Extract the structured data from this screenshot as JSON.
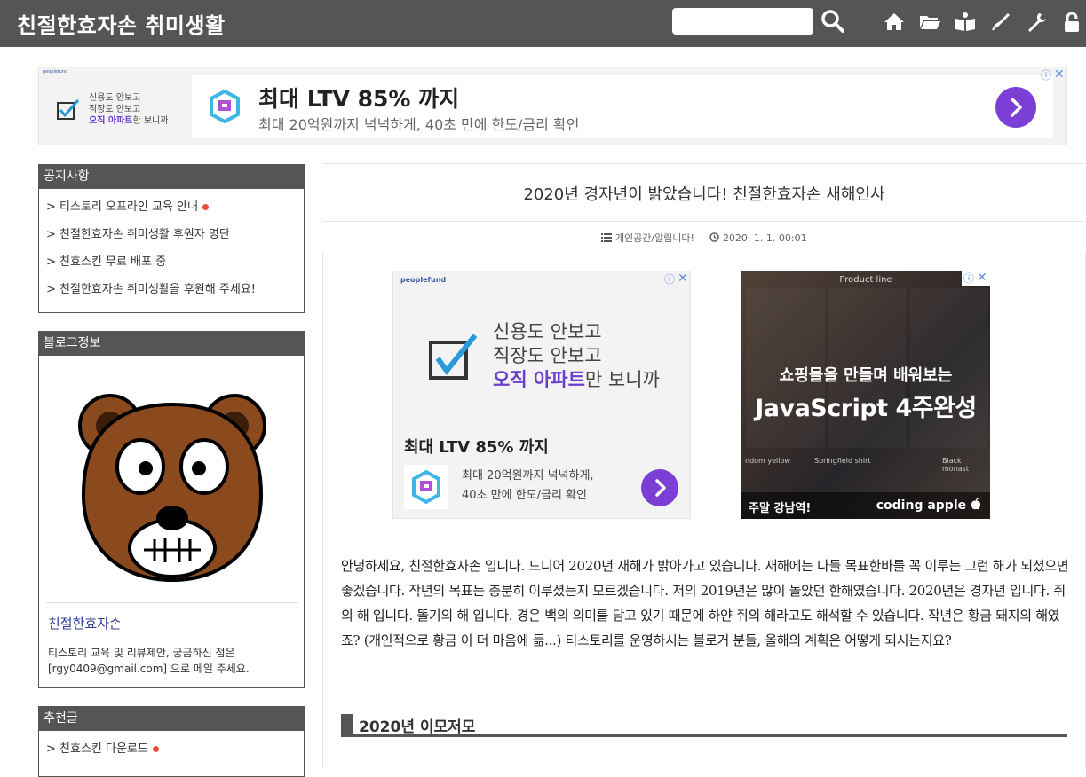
{
  "header": {
    "blog_title": "친절한효자손 취미생활",
    "search_placeholder": "",
    "nav_icons": [
      "search-icon",
      "home-icon",
      "folder-icon",
      "guestbook-icon",
      "write-icon",
      "settings-icon",
      "lock-icon"
    ]
  },
  "top_ad": {
    "brand": "peoplefund",
    "left_text": [
      "신용도 안보고",
      "직장도 안보고"
    ],
    "left_highlight": "오직 아파트",
    "left_tail": "한 보니까",
    "headline": "최대 LTV 85% 까지",
    "subline": "최대 20억원까지 넉넉하게, 40초 만에 한도/금리 확인",
    "adchoice": "ⓘ",
    "close": "✕"
  },
  "sidebar": {
    "notice": {
      "title": "공지사항",
      "items": [
        "> 티스토리 오프라인 교육 안내",
        "> 친절한효자손 취미생활 후원자 명단",
        "> 친효스킨 무료 배포 중",
        "> 친절한효자손 취미생활을 후원해 주세요!"
      ]
    },
    "blog_info": {
      "title": "블로그정보",
      "name": "친절한효자손",
      "desc_line1": "티스토리 교육 및 리뷰제안, 궁금하신 점은",
      "desc_line2": "[rgy0409@gmail.com] 으로 메일 주세요."
    },
    "recommend": {
      "title": "추천글",
      "items": [
        "> 친효스킨 다운로드"
      ]
    }
  },
  "post": {
    "title": "2020년 경자년이 밝았습니다! 친절한효자손 새해인사",
    "category": "개인공간/알립니다!",
    "date": "2020. 1. 1. 00:01",
    "body": "안녕하세요, 친절한효자손 입니다. 드디어 2020년 새해가 밝아가고 있습니다. 새해에는 다들 목표한바를 꼭 이루는 그런 해가 되셨으면 좋겠습니다. 작년의 목표는 충분히 이루셨는지 모르겠습니다. 저의 2019년은 많이 놀았던 한해였습니다. 2020년은 경자년 입니다. 쥐의 해 입니다. 똘기의 해 입니다. 경은 백의 의미를 담고 있기 때문에 하얀 쥐의 해라고도 해석할 수 있습니다. 작년은 황금 돼지의 해였죠? (개인적으로 황금 이 더 마음에 듦...) 티스토리를 운영하시는 블로거 분들, 올해의 계획은 어떻게 되시는지요?",
    "section_heading": "2020년 이모저모"
  },
  "mid_ad": {
    "brand": "peoplefund",
    "lines": [
      "신용도 안보고",
      "직장도 안보고"
    ],
    "highlight": "오직 아파트",
    "tail": "만 보니까",
    "headline": "최대 LTV 85% 까지",
    "sub1": "최대 20억원까지 넉넉하게,",
    "sub2": "40초 만에 한도/금리 확인"
  },
  "right_ad": {
    "top_label": "Product line",
    "line1": "쇼핑몰을 만들며 배워보는",
    "line2": "JavaScript 4주완성",
    "cap1": "Springfield shirt",
    "cap2": "Black monast",
    "cap0": "ndom yellow",
    "bottom_left": "주말 강남역!",
    "bottom_right": "coding apple"
  }
}
